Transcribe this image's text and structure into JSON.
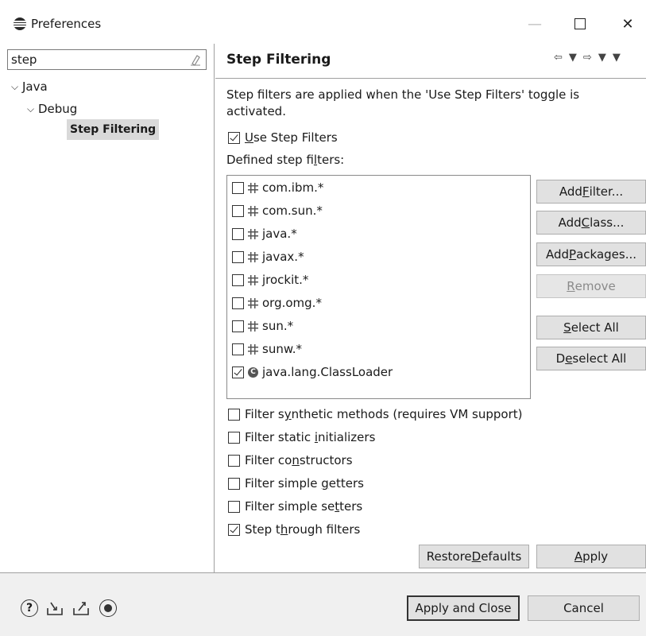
{
  "window": {
    "title": "Preferences",
    "minimize_label": "—",
    "close_label": "✕"
  },
  "sidebar": {
    "filter_value": "step",
    "tree": [
      {
        "label": "Java"
      },
      {
        "label": "Debug"
      },
      {
        "label": "Step Filtering"
      }
    ]
  },
  "page": {
    "title": "Step Filtering",
    "description": "Step filters are applied when the 'Use Step Filters' toggle is activated.",
    "use_step_filters": {
      "mnemonic": "U",
      "rest": "se Step Filters",
      "checked": true
    },
    "defined_label": {
      "before": "Defined step fi",
      "mnemonic": "l",
      "after": "ters:"
    },
    "filters": [
      {
        "label": "com.ibm.*",
        "checked": false,
        "kind": "package"
      },
      {
        "label": "com.sun.*",
        "checked": false,
        "kind": "package"
      },
      {
        "label": "java.*",
        "checked": false,
        "kind": "package"
      },
      {
        "label": "javax.*",
        "checked": false,
        "kind": "package"
      },
      {
        "label": "jrockit.*",
        "checked": false,
        "kind": "package"
      },
      {
        "label": "org.omg.*",
        "checked": false,
        "kind": "package"
      },
      {
        "label": "sun.*",
        "checked": false,
        "kind": "package"
      },
      {
        "label": "sunw.*",
        "checked": false,
        "kind": "package"
      },
      {
        "label": "java.lang.ClassLoader",
        "checked": true,
        "kind": "class"
      }
    ],
    "buttons": {
      "add_filter": {
        "before": "Add ",
        "mnemonic": "F",
        "after": "ilter..."
      },
      "add_class": {
        "before": "Add ",
        "mnemonic": "C",
        "after": "lass..."
      },
      "add_packages": {
        "before": "Add ",
        "mnemonic": "P",
        "after": "ackages..."
      },
      "remove": {
        "before": "",
        "mnemonic": "R",
        "after": "emove"
      },
      "select_all": {
        "before": "",
        "mnemonic": "S",
        "after": "elect All"
      },
      "deselect_all": {
        "before": "D",
        "mnemonic": "e",
        "after": "select All"
      },
      "restore_defaults": {
        "before": "Restore ",
        "mnemonic": "D",
        "after": "efaults"
      },
      "apply": {
        "before": "",
        "mnemonic": "A",
        "after": "pply"
      }
    },
    "options": {
      "synthetic": {
        "before": "Filter s",
        "mnemonic": "y",
        "after": "nthetic methods (requires VM support)",
        "checked": false
      },
      "static": {
        "before": "Filter static ",
        "mnemonic": "i",
        "after": "nitializers",
        "checked": false
      },
      "constructors": {
        "before": "Filter co",
        "mnemonic": "n",
        "after": "structors",
        "checked": false
      },
      "getters": {
        "before": "Filter simple ",
        "mnemonic": "g",
        "after": "etters",
        "checked": false
      },
      "setters": {
        "before": "Filter simple se",
        "mnemonic": "t",
        "after": "ters",
        "checked": false
      },
      "through": {
        "before": "Step t",
        "mnemonic": "h",
        "after": "rough filters",
        "checked": true
      }
    }
  },
  "footer": {
    "help_glyph": "?",
    "apply_close_label": "Apply and Close",
    "cancel_label": "Cancel"
  }
}
